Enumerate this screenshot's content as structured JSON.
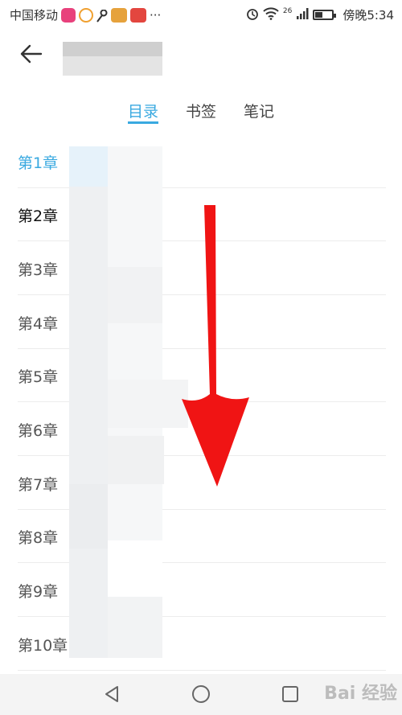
{
  "statusbar": {
    "carrier": "中国移动",
    "more": "···",
    "network": "26",
    "time": "傍晚5:34",
    "icons": [
      "video-icon",
      "ring-icon",
      "key-icon",
      "game-icon",
      "news-icon",
      "alarm-icon",
      "wifi-icon",
      "signal-icon",
      "battery-icon"
    ]
  },
  "tabs": [
    {
      "label": "目录",
      "active": true
    },
    {
      "label": "书签",
      "active": false
    },
    {
      "label": "笔记",
      "active": false
    }
  ],
  "chapters": [
    {
      "label": "第1章",
      "state": "current"
    },
    {
      "label": "第2章",
      "state": "bold"
    },
    {
      "label": "第3章",
      "state": "normal"
    },
    {
      "label": "第4章",
      "state": "normal"
    },
    {
      "label": "第5章",
      "state": "normal"
    },
    {
      "label": "第6章",
      "state": "normal"
    },
    {
      "label": "第7章",
      "state": "normal"
    },
    {
      "label": "第8章",
      "state": "normal"
    },
    {
      "label": "第9章",
      "state": "normal"
    },
    {
      "label": "第10章",
      "state": "normal"
    }
  ],
  "navbar": {
    "icons": [
      "back-triangle-icon",
      "home-circle-icon",
      "recents-square-icon"
    ]
  },
  "watermark": "Bai 经验",
  "colors": {
    "accent": "#39a9e0",
    "arrow": "#f01414",
    "divider": "#ececec"
  }
}
